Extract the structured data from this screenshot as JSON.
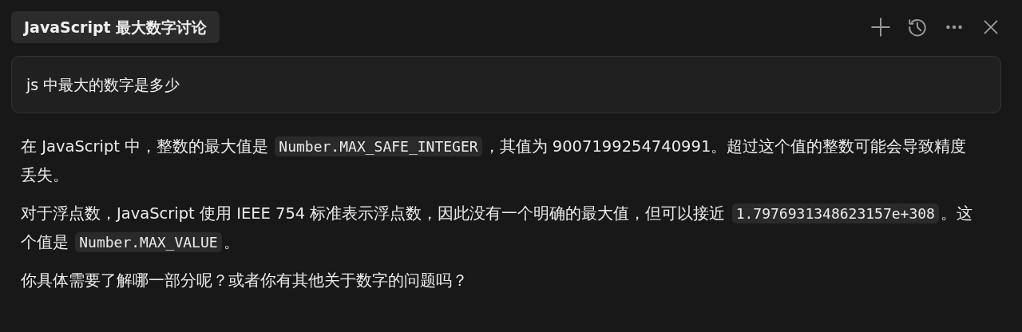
{
  "header": {
    "title": "JavaScript 最大数字讨论",
    "actions": [
      {
        "kind": "add"
      },
      {
        "kind": "history"
      },
      {
        "kind": "more"
      },
      {
        "kind": "close"
      }
    ]
  },
  "question": {
    "text": "js 中最大的数字是多少"
  },
  "answer": {
    "paragraphs": [
      [
        {
          "kind": "text",
          "text": "在 JavaScript 中，整数的最大值是 "
        },
        {
          "kind": "code",
          "text": "Number.MAX_SAFE_INTEGER"
        },
        {
          "kind": "text",
          "text": "，其值为 9007199254740991。超过这个值的整数可能会导致精度丢失。"
        }
      ],
      [
        {
          "kind": "text",
          "text": "对于浮点数，JavaScript 使用 IEEE 754 标准表示浮点数，因此没有一个明确的最大值，但可以接近 "
        },
        {
          "kind": "code",
          "text": "1.7976931348623157e+308"
        },
        {
          "kind": "text",
          "text": "。这个值是 "
        },
        {
          "kind": "code",
          "text": "Number.MAX_VALUE"
        },
        {
          "kind": "text",
          "text": "。"
        }
      ],
      [
        {
          "kind": "text",
          "text": "你具体需要了解哪一部分呢？或者你有其他关于数字的问题吗？"
        }
      ]
    ]
  }
}
